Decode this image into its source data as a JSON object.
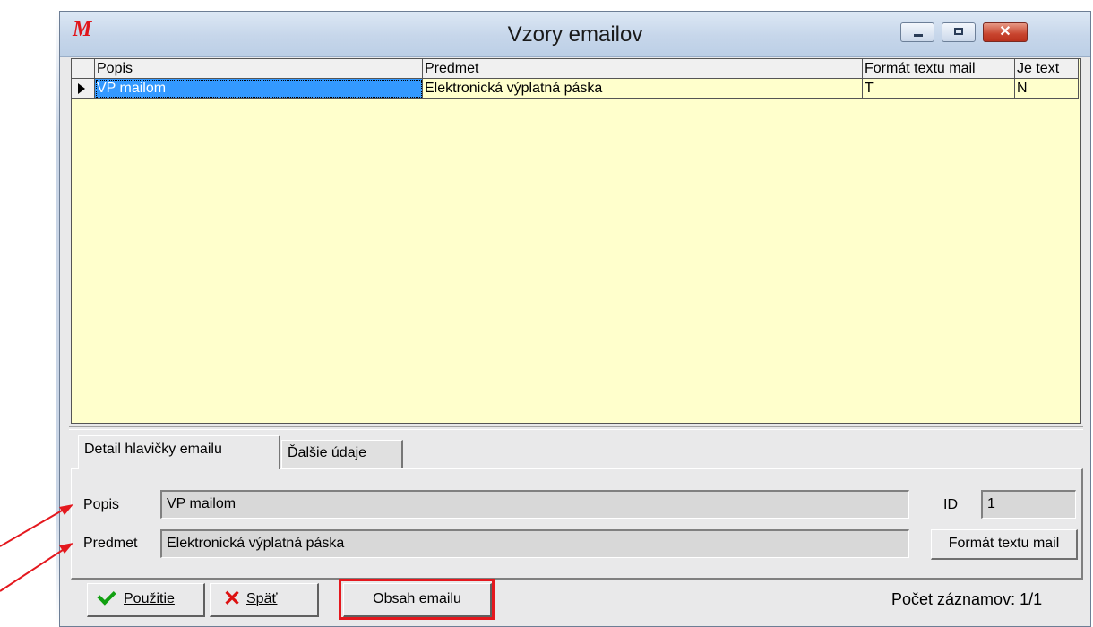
{
  "window": {
    "title": "Vzory emailov",
    "app_icon_glyph": "M",
    "close_glyph": "✕"
  },
  "grid": {
    "columns": [
      "Popis",
      "Predmet",
      "Formát textu mail",
      "Je text"
    ],
    "rows": [
      {
        "popis": "VP mailom",
        "predmet": "Elektronická výplatná páska",
        "format": "T",
        "je_text": "N"
      }
    ]
  },
  "tabs": [
    {
      "label": "Detail hlavičky emailu",
      "active": true
    },
    {
      "label": "Ďalšie údaje",
      "active": false
    }
  ],
  "detail": {
    "popis_label": "Popis",
    "popis_value": "VP mailom",
    "id_label": "ID",
    "id_value": "1",
    "predmet_label": "Predmet",
    "predmet_value": "Elektronická výplatná páska",
    "format_button": "Formát textu mail"
  },
  "buttons": {
    "pouzitie": "Použitie",
    "spat": "Späť",
    "obsah": "Obsah emailu"
  },
  "status": "Počet záznamov: 1/1",
  "colors": {
    "grid_background": "#ffffcc",
    "selection": "#3399ff",
    "annotation": "#e4181e"
  }
}
